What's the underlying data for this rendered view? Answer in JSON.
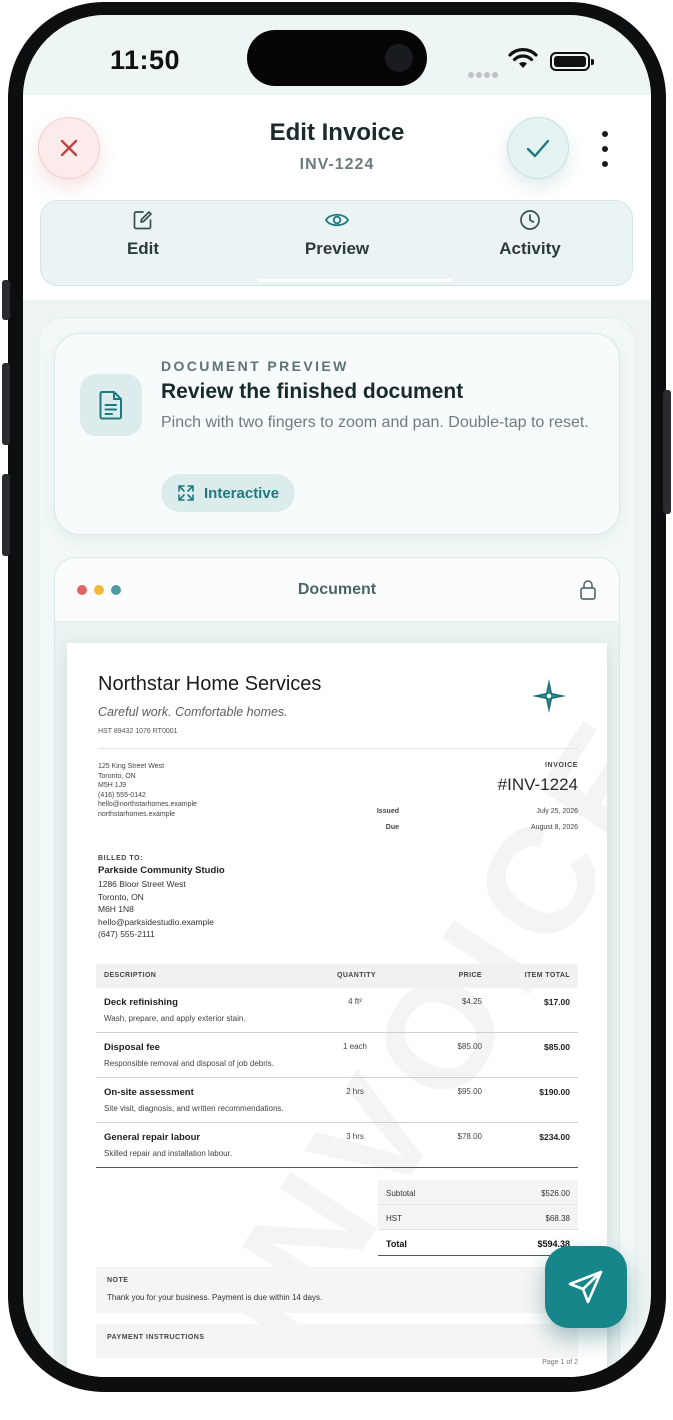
{
  "status_bar": {
    "time": "11:50"
  },
  "header": {
    "title": "Edit Invoice",
    "subtitle": "INV-1224",
    "tabs": [
      {
        "label": "Edit",
        "icon": "edit-icon"
      },
      {
        "label": "Preview",
        "icon": "eye-icon"
      },
      {
        "label": "Activity",
        "icon": "clock-icon"
      }
    ],
    "active_tab": "Preview"
  },
  "preview_card": {
    "eyebrow": "DOCUMENT PREVIEW",
    "title": "Review the finished document",
    "description": "Pinch with two fingers to zoom and pan. Double-tap to reset.",
    "pill_label": "Interactive"
  },
  "document": {
    "bar_title": "Document",
    "company": {
      "name": "Northstar Home Services",
      "tagline": "Careful work. Comfortable homes.",
      "hst": "HST 89432 1076 RT0001",
      "address_lines": [
        "125 King Street West",
        "Toronto, ON",
        "M5H 1J9",
        "(416) 555-0142",
        "hello@northstarhomes.example",
        "northstarhomes.example"
      ]
    },
    "invoice_label": "INVOICE",
    "invoice_number": "#INV-1224",
    "issued_label": "Issued",
    "issued_date": "July 25, 2026",
    "due_label": "Due",
    "due_date": "August 8, 2026",
    "billed_to": {
      "label": "BILLED TO:",
      "name": "Parkside Community Studio",
      "lines": [
        "1286 Bloor Street West",
        "Toronto, ON",
        "M6H 1N8",
        "hello@parksidestudio.example",
        "(647) 555-2111"
      ]
    },
    "table": {
      "headers": {
        "description": "DESCRIPTION",
        "quantity": "QUANTITY",
        "price": "PRICE",
        "total": "ITEM TOTAL"
      },
      "rows": [
        {
          "name": "Deck refinishing",
          "detail": "Wash, prepare, and apply exterior stain.",
          "quantity": "4 ft²",
          "price": "$4.25",
          "total": "$17.00"
        },
        {
          "name": "Disposal fee",
          "detail": "Responsible removal and disposal of job debris.",
          "quantity": "1 each",
          "price": "$85.00",
          "total": "$85.00"
        },
        {
          "name": "On-site assessment",
          "detail": "Site visit, diagnosis, and written recommendations.",
          "quantity": "2 hrs",
          "price": "$95.00",
          "total": "$190.00"
        },
        {
          "name": "General repair labour",
          "detail": "Skilled repair and installation labour.",
          "quantity": "3 hrs",
          "price": "$78.00",
          "total": "$234.00"
        }
      ]
    },
    "totals": {
      "subtotal_label": "Subtotal",
      "subtotal": "$526.00",
      "tax_label": "HST",
      "tax": "$68.38",
      "total_label": "Total",
      "total": "$594.38"
    },
    "note": {
      "label": "NOTE",
      "text": "Thank you for your business. Payment is due within 14 days."
    },
    "payment_label": "PAYMENT INSTRUCTIONS",
    "page_indicator": "Page 1 of 2",
    "watermark": "INVOICE"
  },
  "colors": {
    "accent": "#17868a",
    "close_red": "#c0433f",
    "dot_red": "#e06666",
    "dot_yellow": "#f0b93a",
    "dot_teal": "#4e9aa0"
  }
}
